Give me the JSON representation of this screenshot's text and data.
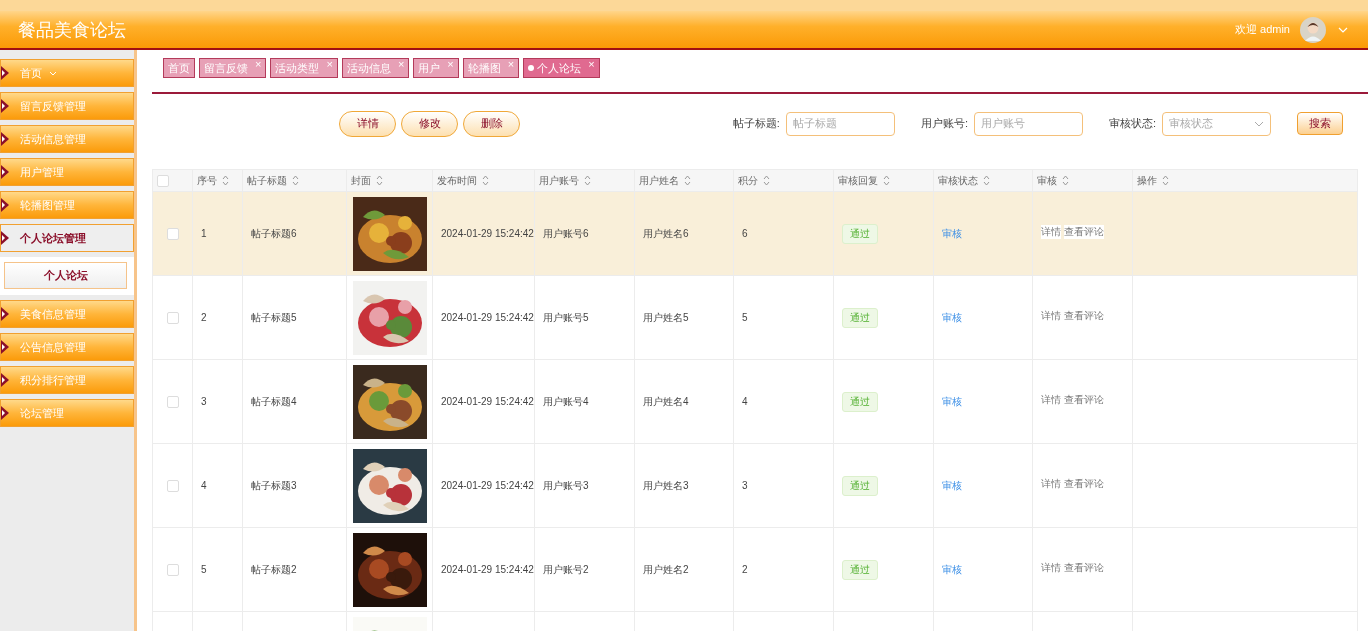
{
  "header": {
    "title": "餐品美食论坛",
    "welcome": "欢迎 admin"
  },
  "sidebar": {
    "items": [
      {
        "label": "首页",
        "expanded": false,
        "has_caret": true
      },
      {
        "label": "留言反馈管理",
        "expanded": false
      },
      {
        "label": "活动信息管理",
        "expanded": false
      },
      {
        "label": "用户管理",
        "expanded": false
      },
      {
        "label": "轮播图管理",
        "expanded": false
      },
      {
        "label": "个人论坛管理",
        "expanded": true,
        "children": [
          {
            "label": "个人论坛",
            "selected": true
          }
        ]
      },
      {
        "label": "美食信息管理",
        "expanded": false
      },
      {
        "label": "公告信息管理",
        "expanded": false
      },
      {
        "label": "积分排行管理",
        "expanded": false
      },
      {
        "label": "论坛管理",
        "expanded": false
      }
    ]
  },
  "tabs": [
    {
      "label": "首页",
      "closable": false,
      "selected": false
    },
    {
      "label": "留言反馈",
      "closable": true,
      "selected": false
    },
    {
      "label": "活动类型",
      "closable": true,
      "selected": false
    },
    {
      "label": "活动信息",
      "closable": true,
      "selected": false
    },
    {
      "label": "用户",
      "closable": true,
      "selected": false
    },
    {
      "label": "轮播图",
      "closable": true,
      "selected": false
    },
    {
      "label": "个人论坛",
      "closable": true,
      "selected": true
    }
  ],
  "close_glyph": "×",
  "actions": [
    "详情",
    "修改",
    "删除"
  ],
  "filters": [
    {
      "label": "帖子标题:",
      "placeholder": "帖子标题",
      "kind": "text"
    },
    {
      "label": "用户账号:",
      "placeholder": "用户账号",
      "kind": "text"
    },
    {
      "label": "审核状态:",
      "placeholder": "审核状态",
      "kind": "select"
    }
  ],
  "search_button": "搜索",
  "table": {
    "columns": [
      "序号",
      "帖子标题",
      "封面",
      "发布时间",
      "用户账号",
      "用户姓名",
      "积分",
      "审核回复",
      "审核状态",
      "审核",
      "操作"
    ],
    "rows": [
      {
        "checked": false,
        "highlighted": true,
        "no": "1",
        "title": "帖子标题6",
        "cover": {
          "kind": "picture"
        },
        "time": "2024-01-29 15:24:42",
        "account": "用户账号6",
        "name": "用户姓名6",
        "points": "6",
        "status": "通过",
        "review": "审核",
        "ops": [
          "详情",
          "查看评论"
        ]
      },
      {
        "checked": false,
        "highlighted": false,
        "no": "2",
        "title": "帖子标题5",
        "cover": {
          "kind": "picture"
        },
        "time": "2024-01-29 15:24:42",
        "account": "用户账号5",
        "name": "用户姓名5",
        "points": "5",
        "status": "通过",
        "review": "审核",
        "ops": [
          "详情",
          "查看评论"
        ]
      },
      {
        "checked": false,
        "highlighted": false,
        "no": "3",
        "title": "帖子标题4",
        "cover": {
          "kind": "picture"
        },
        "time": "2024-01-29 15:24:42",
        "account": "用户账号4",
        "name": "用户姓名4",
        "points": "4",
        "status": "通过",
        "review": "审核",
        "ops": [
          "详情",
          "查看评论"
        ]
      },
      {
        "checked": false,
        "highlighted": false,
        "no": "4",
        "title": "帖子标题3",
        "cover": {
          "kind": "picture"
        },
        "time": "2024-01-29 15:24:42",
        "account": "用户账号3",
        "name": "用户姓名3",
        "points": "3",
        "status": "通过",
        "review": "审核",
        "ops": [
          "详情",
          "查看评论"
        ]
      },
      {
        "checked": false,
        "highlighted": false,
        "no": "5",
        "title": "帖子标题2",
        "cover": {
          "kind": "picture"
        },
        "time": "2024-01-29 15:24:42",
        "account": "用户账号2",
        "name": "用户姓名2",
        "points": "2",
        "status": "通过",
        "review": "审核",
        "ops": [
          "详情",
          "查看评论"
        ]
      },
      {
        "highlighted": false,
        "cover": {
          "kind": "picture"
        }
      }
    ],
    "all_checked": false
  }
}
